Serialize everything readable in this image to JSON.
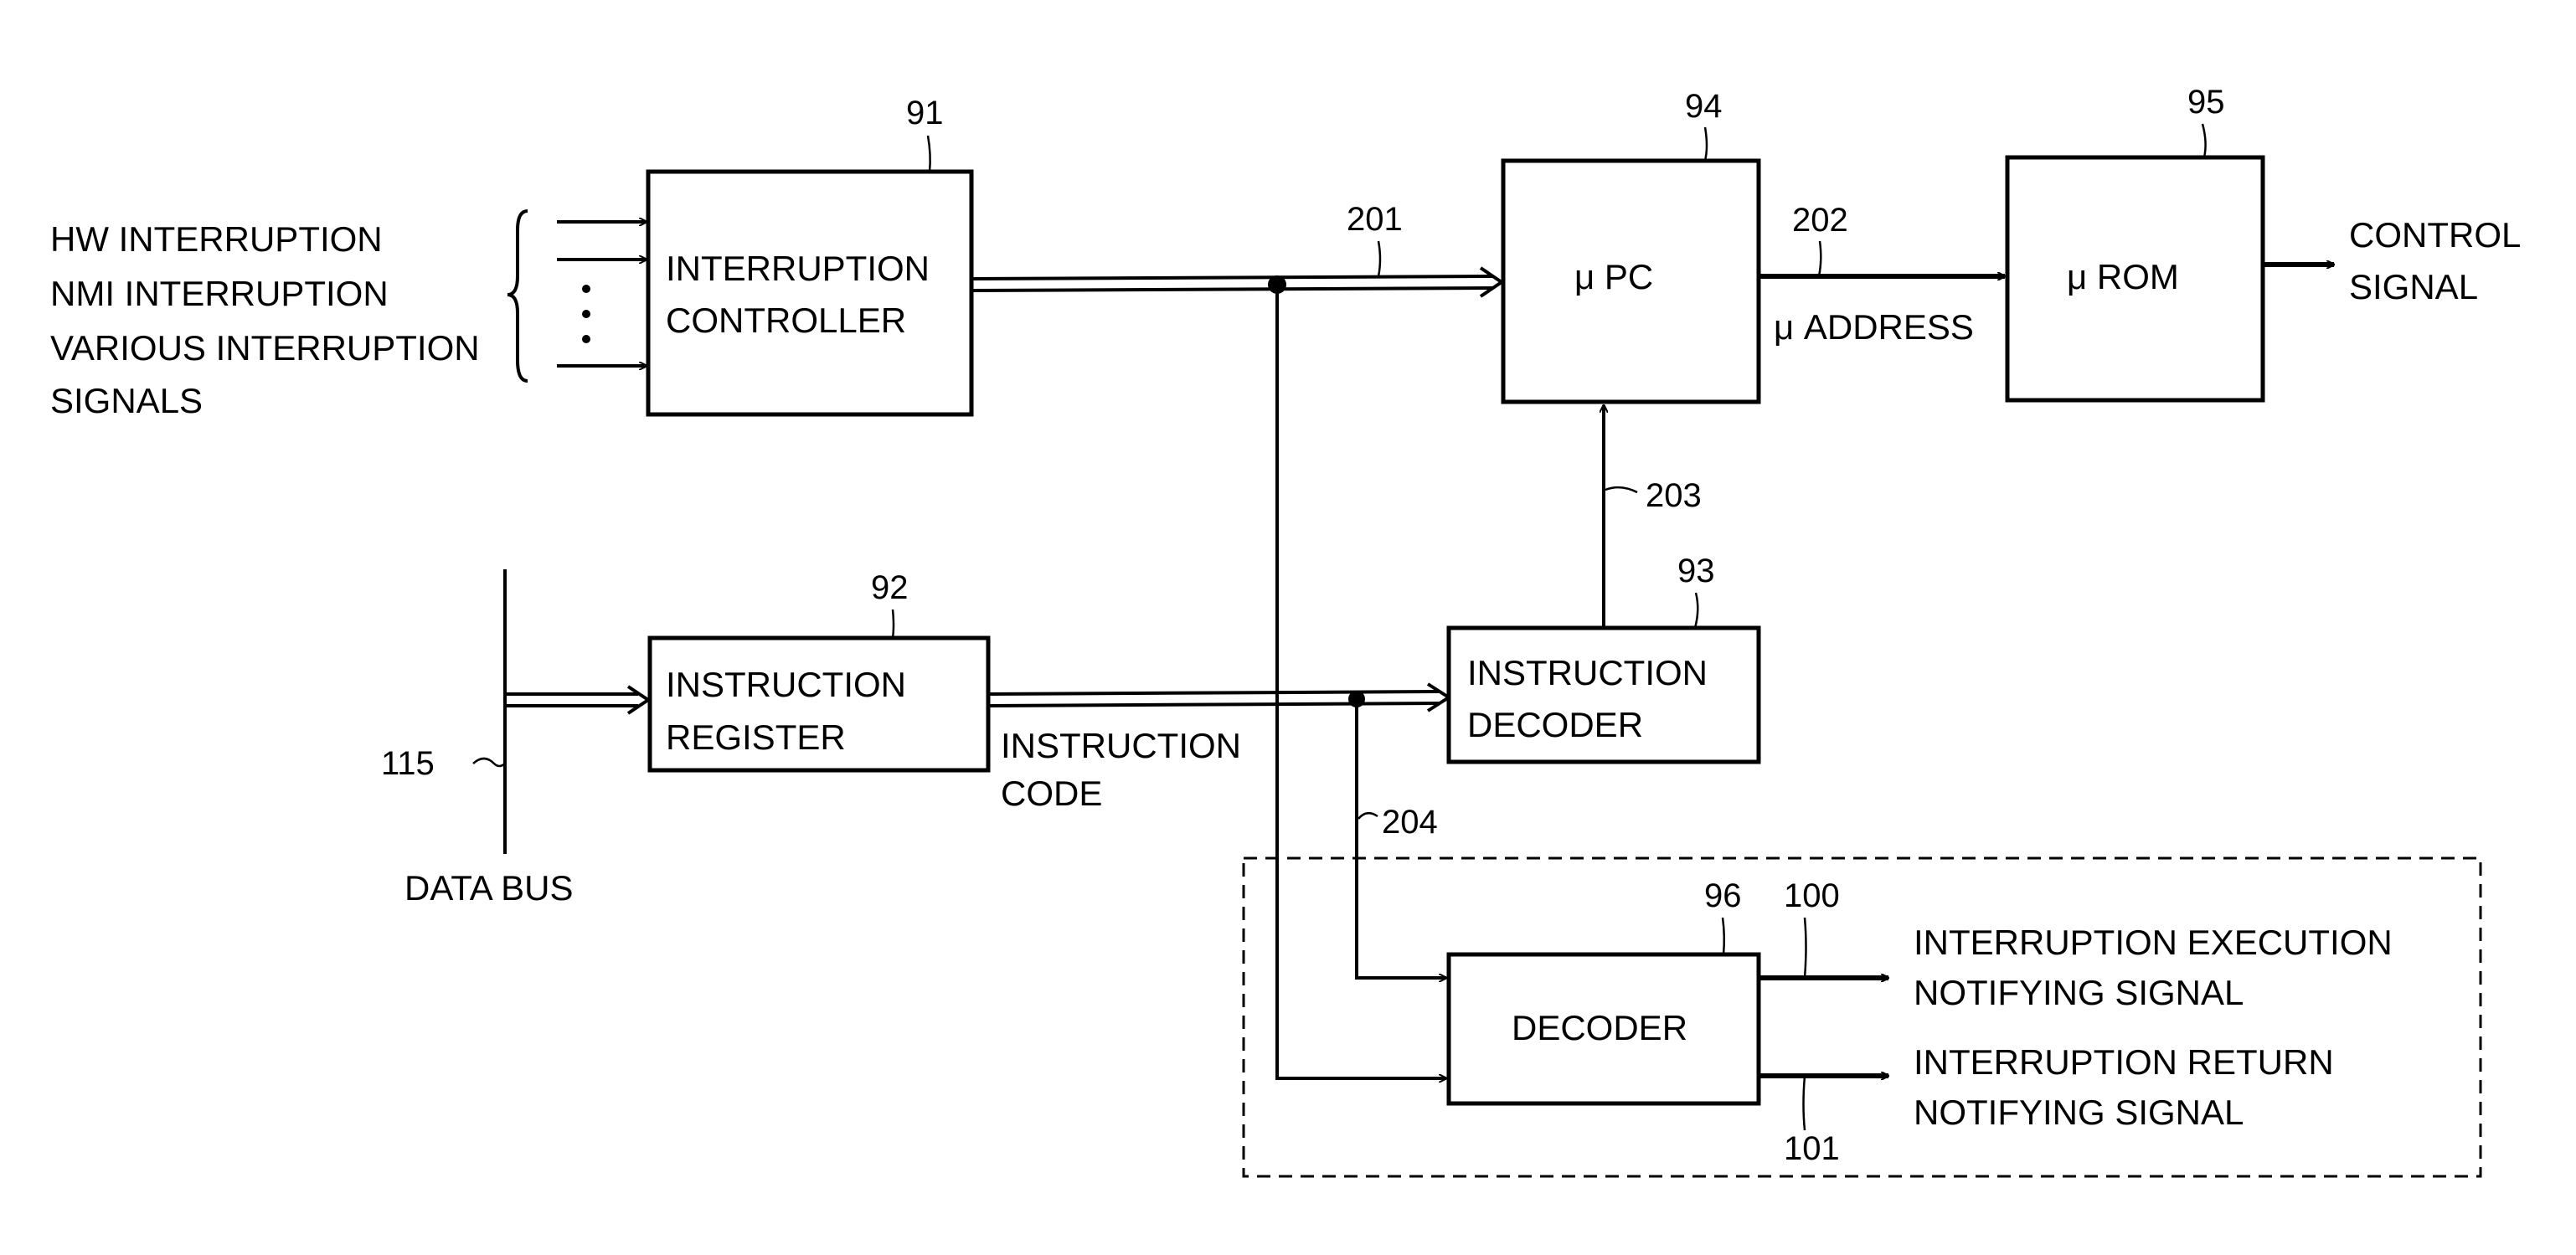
{
  "blocks": {
    "interruption_controller": {
      "ref": "91",
      "line1": "INTERRUPTION",
      "line2": "CONTROLLER"
    },
    "instruction_register": {
      "ref": "92",
      "line1": "INSTRUCTION",
      "line2": "REGISTER"
    },
    "instruction_decoder": {
      "ref": "93",
      "line1": "INSTRUCTION",
      "line2": "DECODER"
    },
    "micro_pc": {
      "ref": "94",
      "label": "μ PC"
    },
    "micro_rom": {
      "ref": "95",
      "label": "μ ROM"
    },
    "decoder": {
      "ref": "96",
      "label": "DECODER"
    }
  },
  "inputs": {
    "lines": [
      "HW INTERRUPTION",
      "NMI INTERRUPTION",
      "VARIOUS INTERRUPTION",
      "SIGNALS"
    ],
    "ellipsis": "⋮"
  },
  "signals": {
    "s201": "201",
    "s202": "202",
    "s203": "203",
    "s204": "204",
    "s100": "100",
    "s101": "101",
    "s115": "115"
  },
  "labels": {
    "micro_address": "μ ADDRESS",
    "control_signal_1": "CONTROL",
    "control_signal_2": "SIGNAL",
    "instruction_code_1": "INSTRUCTION",
    "instruction_code_2": "CODE",
    "data_bus": "DATA BUS",
    "exec_notify_1": "INTERRUPTION EXECUTION",
    "exec_notify_2": "NOTIFYING SIGNAL",
    "return_notify_1": "INTERRUPTION RETURN",
    "return_notify_2": "NOTIFYING SIGNAL"
  }
}
